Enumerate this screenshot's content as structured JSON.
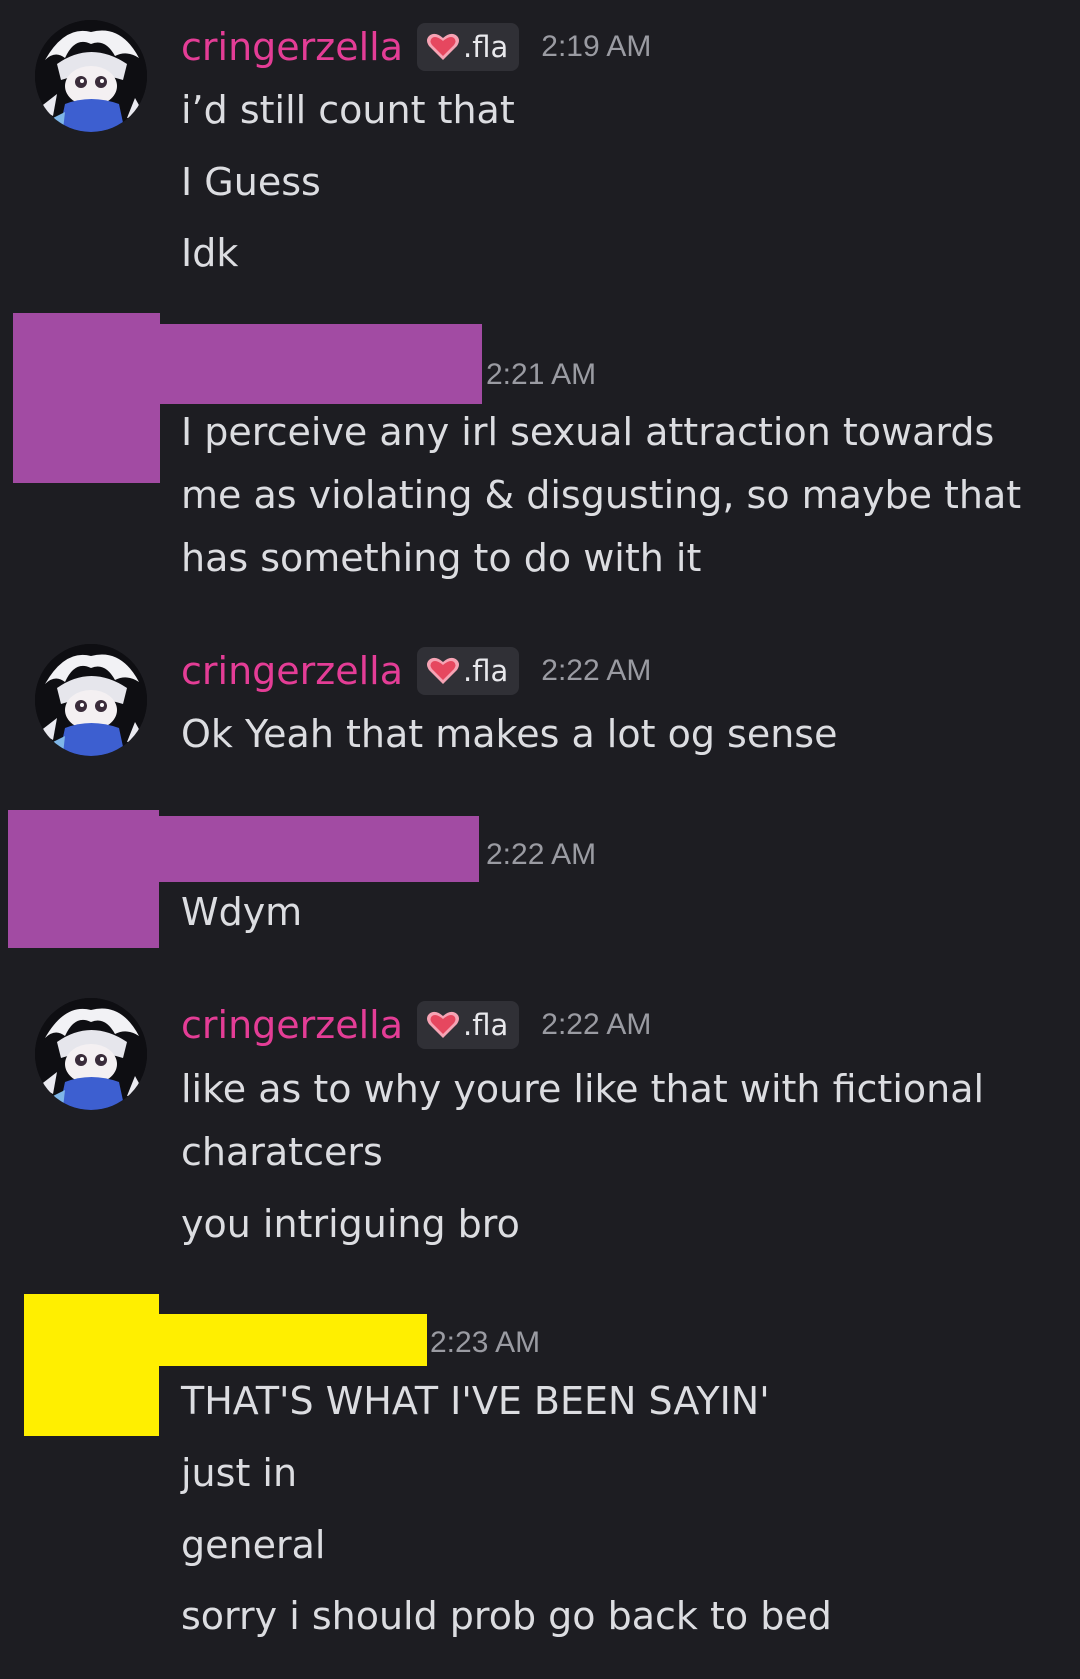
{
  "colors": {
    "background": "#1d1d22",
    "username": "#e43d96",
    "timestamp": "#9a9ba2",
    "message_text": "#dcdde1",
    "tag_background": "#303036",
    "redaction_purple": "#a24ba3",
    "redaction_yellow": "#ffef00"
  },
  "user": {
    "name": "cringerzella",
    "tag_icon": "heart-icon",
    "tag_text": ".fla"
  },
  "groups": [
    {
      "author": "cringerzella",
      "time": "2:19 AM",
      "lines": [
        "i’d still count that",
        "I Guess",
        "Idk"
      ]
    },
    {
      "author": "",
      "time": "2:21 AM",
      "lines": [
        "I perceive any irl sexual attraction towards",
        "me as violating & disgusting, so maybe that",
        "has something to do with it"
      ]
    },
    {
      "author": "cringerzella",
      "time": "2:22 AM",
      "lines": [
        "Ok Yeah that makes a lot og sense"
      ]
    },
    {
      "author": "",
      "time": "2:22 AM",
      "lines": [
        "Wdym"
      ]
    },
    {
      "author": "cringerzella",
      "time": "2:22 AM",
      "lines": [
        "like as to why youre like that with fictional",
        "charatcers",
        "you intriguing bro"
      ]
    },
    {
      "author": "",
      "time": "2:23 AM",
      "lines": [
        "THAT'S WHAT I'VE BEEN SAYIN'",
        "just in",
        "general",
        "sorry i should prob go back to bed"
      ]
    }
  ]
}
